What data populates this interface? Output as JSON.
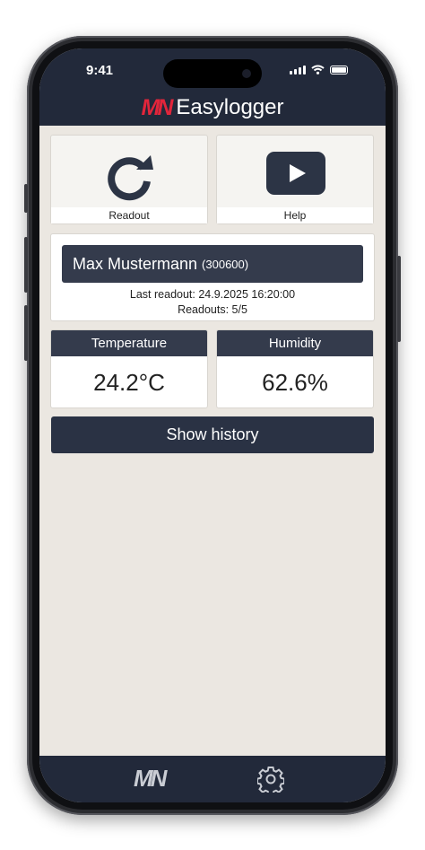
{
  "status_bar": {
    "time": "9:41"
  },
  "header": {
    "logo_mark": "MN",
    "app_name": "Easylogger"
  },
  "actions": [
    {
      "label": "Readout",
      "icon": "refresh-icon"
    },
    {
      "label": "Help",
      "icon": "play-icon"
    }
  ],
  "device": {
    "name": "Max Mustermann",
    "id": "(300600)",
    "last_readout": "Last readout: 24.9.2025 16:20:00",
    "readouts": "Readouts: 5/5"
  },
  "metrics": [
    {
      "title": "Temperature",
      "value": "24.2°C"
    },
    {
      "title": "Humidity",
      "value": "62.6%"
    }
  ],
  "history_button": "Show history",
  "footer": {
    "logo_mark": "MN",
    "settings_icon": "gear-icon"
  },
  "colors": {
    "brand_red": "#e2253b",
    "navy": "#22293a",
    "background": "#ebe7e1"
  }
}
